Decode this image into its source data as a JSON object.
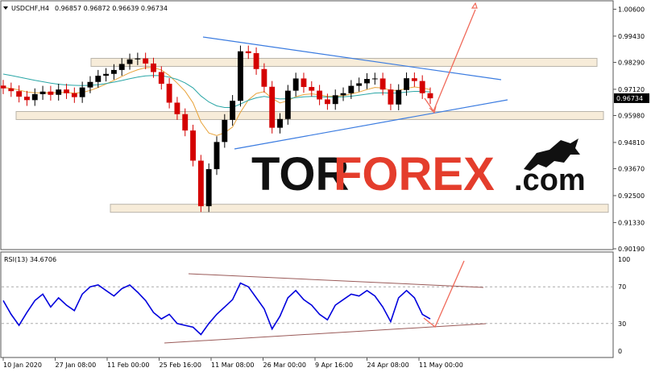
{
  "header": {
    "symbol": "USDCHF,H4",
    "quotes": "0.96857 0.96872 0.96639 0.96734",
    "triangle_icon": "triangle-down-icon"
  },
  "price_axis": {
    "ticks": [
      "1.00600",
      "0.99430",
      "0.98290",
      "0.97120",
      "0.95980",
      "0.94810",
      "0.93670",
      "0.92500",
      "0.91330",
      "0.90190"
    ],
    "current_price_label": "0.96734",
    "current_price_color": "#000000"
  },
  "rsi": {
    "label": "RSI(13) 34.6706",
    "ticks": [
      "100",
      "70",
      "30",
      "0"
    ]
  },
  "time_axis": {
    "labels": [
      "10 Jan 2020",
      "27 Jan 08:00",
      "11 Feb 00:00",
      "25 Feb 16:00",
      "11 Mar 08:00",
      "26 Mar 00:00",
      "9 Apr 16:00",
      "24 Apr 08:00",
      "11 May 00:00"
    ]
  },
  "watermark": {
    "part1": "TOR",
    "part2": "FOREX",
    "part3": ".com",
    "logo": "bull-icon"
  },
  "colors": {
    "bull_candle": "#000000",
    "bear_candle": "#d40000",
    "ma_fast": "#e8a33a",
    "ma_slow": "#2aa6a6",
    "trendline": "#3a7be0",
    "forecast_arrow": "#f06a5a",
    "zone_fill": "#f7ecd9",
    "zone_border": "#b9b4aa",
    "rsi_line": "#0000dd",
    "rsi_trend": "#9a5a58"
  },
  "chart_data": [
    {
      "type": "candlestick",
      "title": "USDCHF,H4",
      "x_labels": [
        "10 Jan 2020",
        "27 Jan 08:00",
        "11 Feb 00:00",
        "25 Feb 16:00",
        "11 Mar 08:00",
        "26 Mar 00:00",
        "9 Apr 16:00",
        "24 Apr 08:00",
        "11 May 00:00"
      ],
      "ylim": [
        0.9019,
        1.0093
      ],
      "open": 0.96857,
      "high": 0.96872,
      "low": 0.96639,
      "close": 0.96734,
      "series": [
        {
          "name": "Close",
          "values": [
            0.9716,
            0.9704,
            0.968,
            0.9665,
            0.9691,
            0.9702,
            0.9688,
            0.9711,
            0.9695,
            0.9678,
            0.972,
            0.9744,
            0.9771,
            0.9779,
            0.9796,
            0.9822,
            0.9842,
            0.9846,
            0.9824,
            0.9787,
            0.9736,
            0.9654,
            0.9604,
            0.9533,
            0.9402,
            0.9204,
            0.9365,
            0.9483,
            0.9579,
            0.9662,
            0.9877,
            0.9869,
            0.98,
            0.9723,
            0.9545,
            0.9583,
            0.9706,
            0.9759,
            0.9722,
            0.9706,
            0.9668,
            0.9648,
            0.9686,
            0.9695,
            0.9727,
            0.9738,
            0.9757,
            0.9759,
            0.9711,
            0.9646,
            0.9709,
            0.976,
            0.9748,
            0.9695,
            0.9673
          ]
        },
        {
          "name": "MA fast",
          "values": [
            0.972,
            0.9716,
            0.9709,
            0.97,
            0.9697,
            0.9697,
            0.9696,
            0.9698,
            0.9698,
            0.9695,
            0.9698,
            0.9707,
            0.972,
            0.9735,
            0.9751,
            0.9768,
            0.9784,
            0.9797,
            0.9806,
            0.9806,
            0.9796,
            0.9772,
            0.9739,
            0.9704,
            0.9653,
            0.957,
            0.9522,
            0.9511,
            0.9523,
            0.9548,
            0.9612,
            0.9666,
            0.9694,
            0.9702,
            0.9672,
            0.9653,
            0.9662,
            0.968,
            0.9689,
            0.9692,
            0.9688,
            0.9681,
            0.9682,
            0.9684,
            0.9692,
            0.97,
            0.9711,
            0.972,
            0.9718,
            0.9707,
            0.9707,
            0.9716,
            0.9722,
            0.9718,
            0.9711
          ]
        },
        {
          "name": "MA slow",
          "values": [
            0.9778,
            0.9772,
            0.9765,
            0.9758,
            0.9751,
            0.9745,
            0.9739,
            0.9734,
            0.9731,
            0.9729,
            0.9728,
            0.9729,
            0.9732,
            0.9737,
            0.9743,
            0.975,
            0.9758,
            0.9765,
            0.977,
            0.9772,
            0.9771,
            0.9765,
            0.9755,
            0.974,
            0.9718,
            0.9683,
            0.9657,
            0.964,
            0.9633,
            0.9633,
            0.9648,
            0.9664,
            0.9675,
            0.9681,
            0.9675,
            0.967,
            0.9671,
            0.9676,
            0.9679,
            0.9681,
            0.968,
            0.9678,
            0.9678,
            0.9679,
            0.9682,
            0.9686,
            0.9691,
            0.9696,
            0.9697,
            0.9695,
            0.9696,
            0.97,
            0.9703,
            0.9703,
            0.9701
          ]
        }
      ]
    },
    {
      "type": "line",
      "title": "RSI(13) 34.6706",
      "ylim": [
        0,
        100
      ],
      "series": [
        {
          "name": "RSI(13)",
          "values": [
            55,
            40,
            28,
            42,
            55,
            62,
            48,
            58,
            50,
            44,
            62,
            70,
            72,
            66,
            60,
            68,
            72,
            64,
            55,
            42,
            35,
            40,
            30,
            28,
            26,
            18,
            30,
            40,
            48,
            56,
            74,
            70,
            58,
            46,
            24,
            38,
            58,
            66,
            56,
            50,
            40,
            34,
            50,
            56,
            62,
            60,
            66,
            60,
            48,
            32,
            58,
            66,
            58,
            40,
            35
          ]
        }
      ]
    }
  ]
}
